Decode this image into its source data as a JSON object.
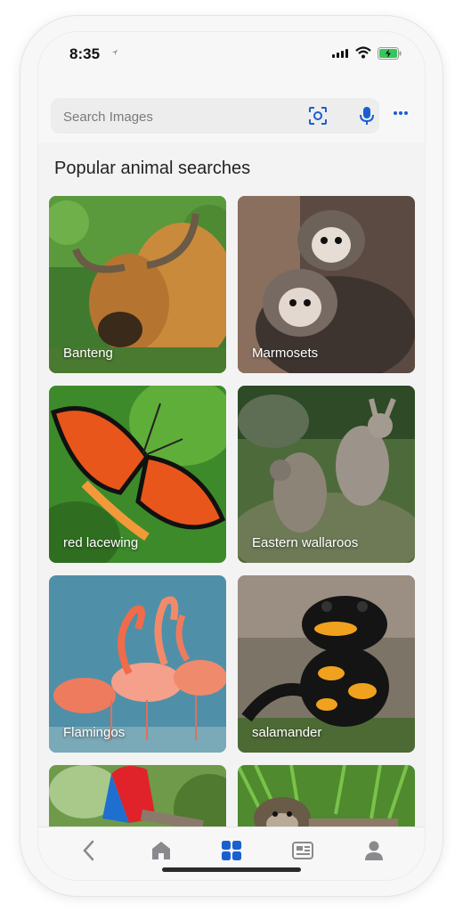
{
  "status_bar": {
    "time": "8:35"
  },
  "search": {
    "placeholder": "Search Images"
  },
  "section_title": "Popular animal searches",
  "tiles": [
    {
      "label": "Banteng"
    },
    {
      "label": "Marmosets"
    },
    {
      "label": "red lacewing"
    },
    {
      "label": "Eastern wallaroos"
    },
    {
      "label": "Flamingos"
    },
    {
      "label": "salamander"
    },
    {
      "label": ""
    },
    {
      "label": ""
    }
  ],
  "tabs": [
    "back",
    "home",
    "apps",
    "news",
    "profile"
  ],
  "colors": {
    "accent": "#1a5fd0",
    "icon_gray": "#8a8a8e"
  }
}
